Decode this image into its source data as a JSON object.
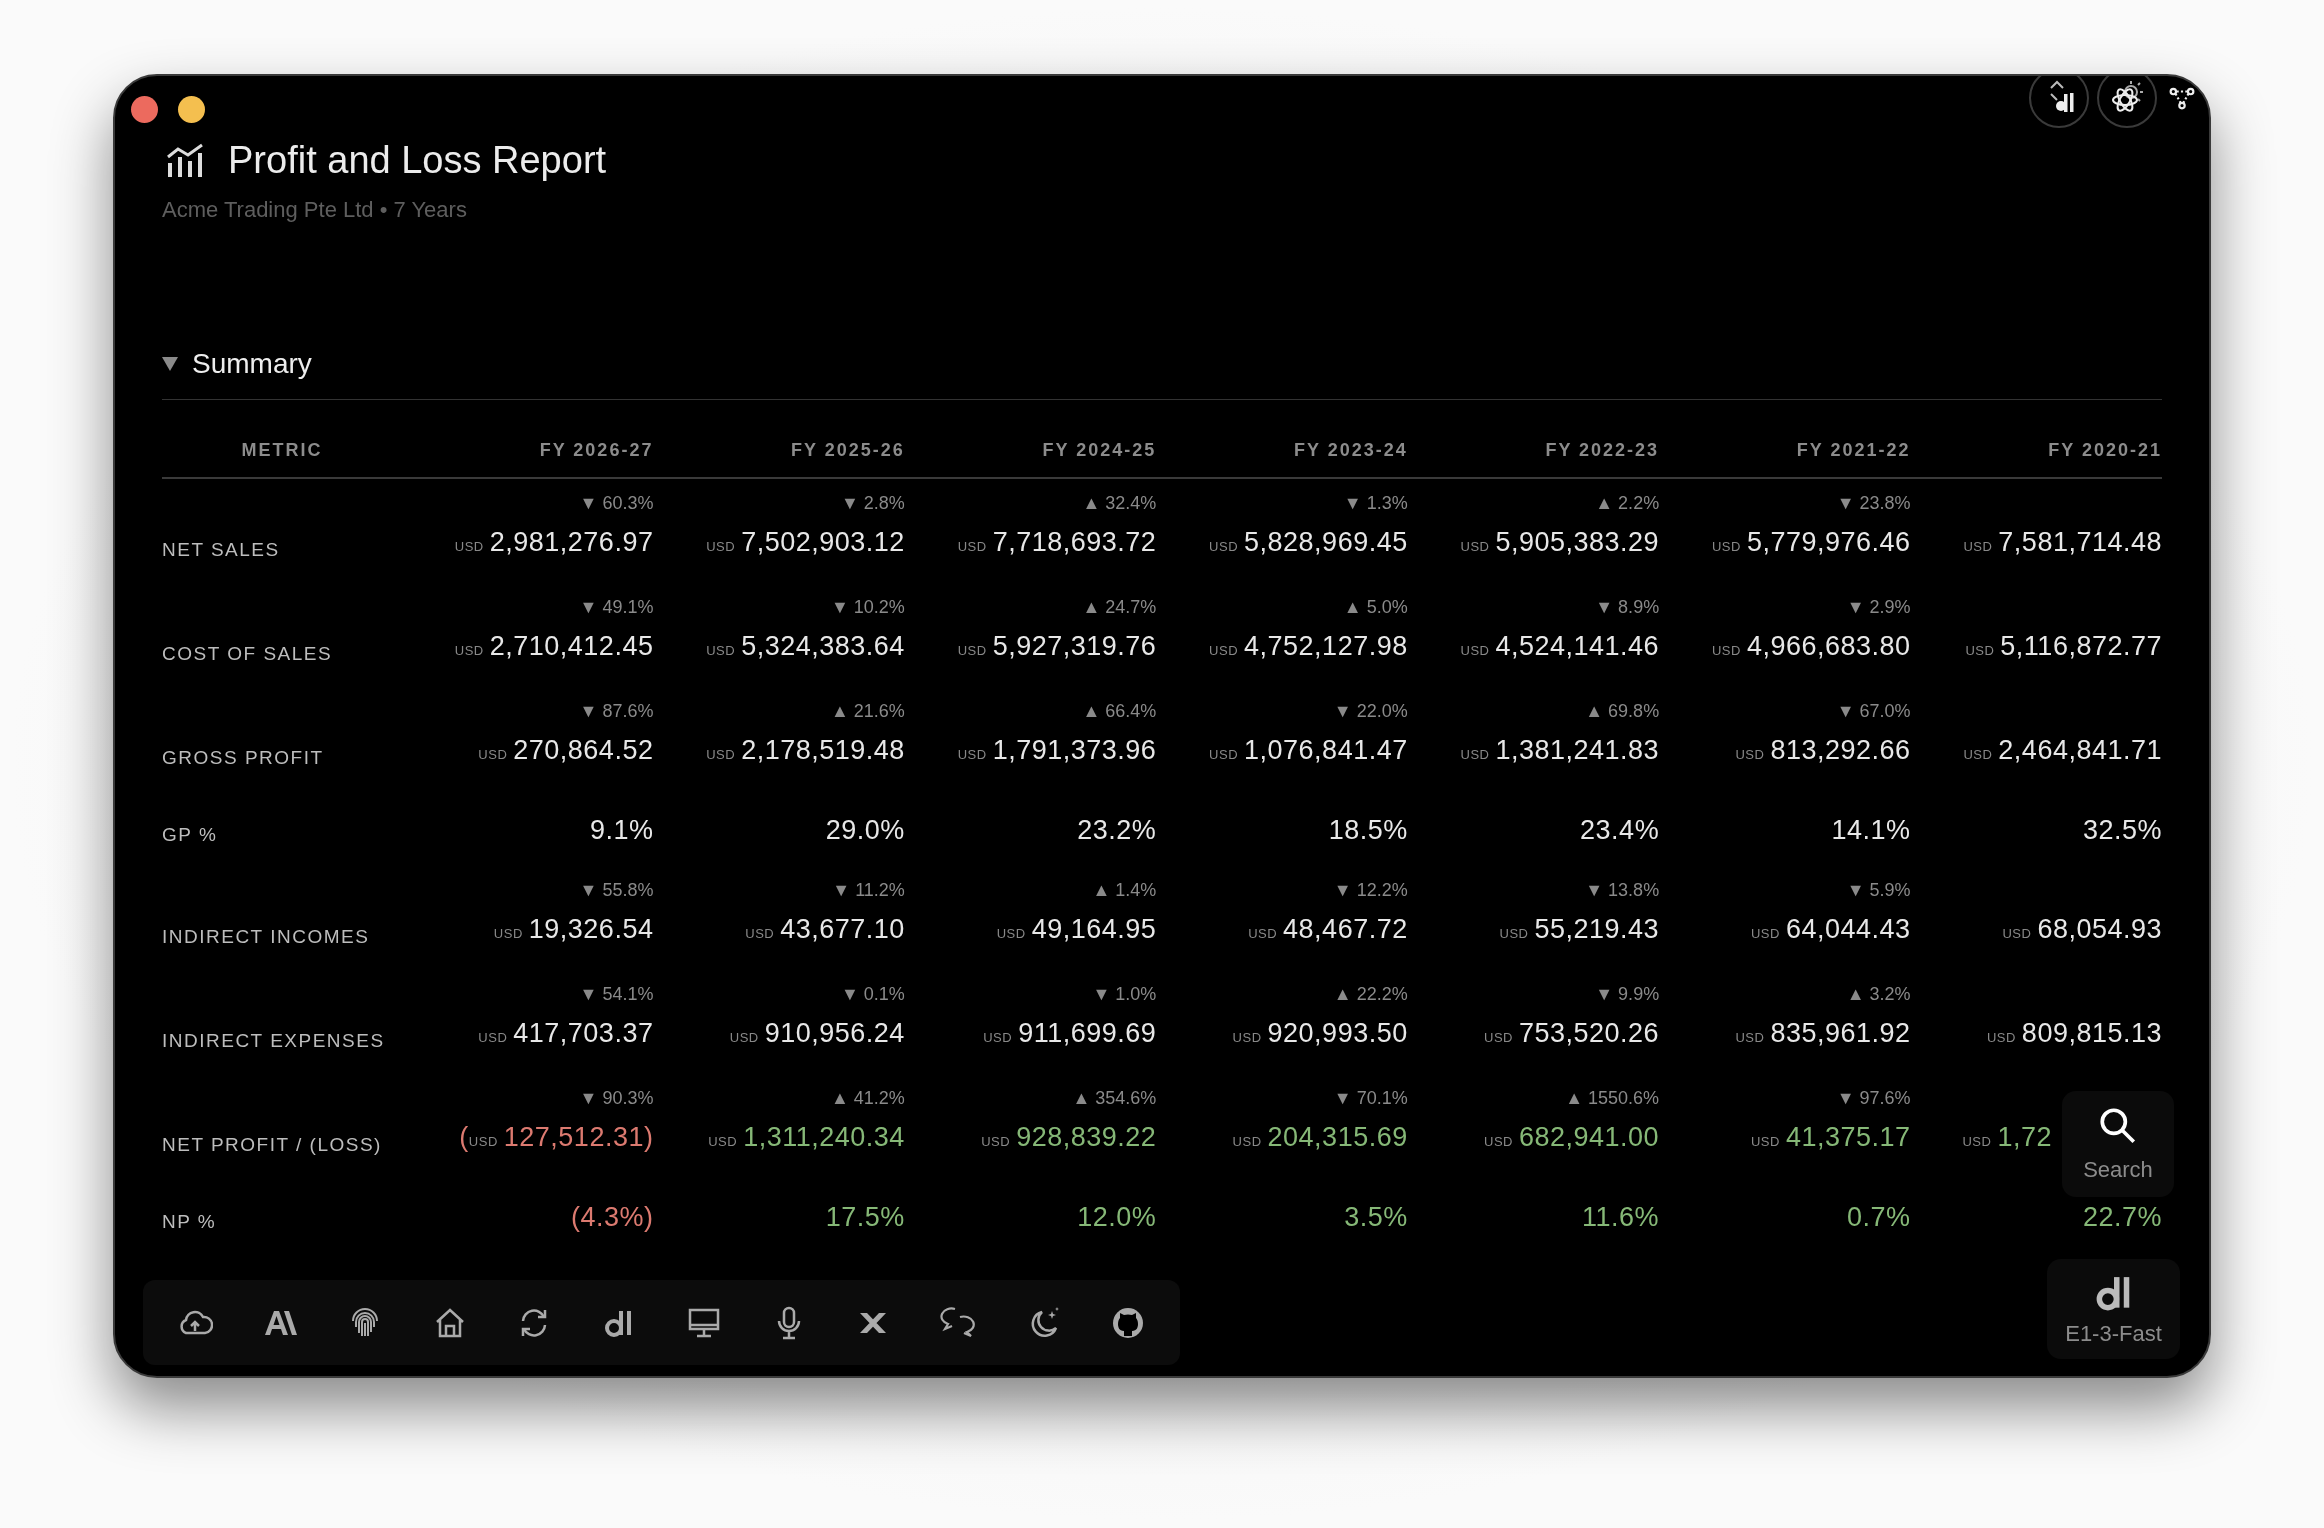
{
  "window": {
    "title": "Profit and Loss Report",
    "subtitle": "Acme Trading Pte Ltd • 7 Years"
  },
  "section": {
    "title": "Summary",
    "expanded": true
  },
  "table": {
    "metric_header": "METRIC",
    "columns": [
      "FY 2026-27",
      "FY 2025-26",
      "FY 2024-25",
      "FY 2023-24",
      "FY 2022-23",
      "FY 2021-22",
      "FY 2020-21"
    ],
    "rows": [
      {
        "label": "NET SALES",
        "cells": [
          {
            "change": "▼ 60.3%",
            "currency": "USD",
            "amount": "2,981,276.97",
            "color": "#e8e8e8"
          },
          {
            "change": "▼ 2.8%",
            "currency": "USD",
            "amount": "7,502,903.12",
            "color": "#e8e8e8"
          },
          {
            "change": "▲ 32.4%",
            "currency": "USD",
            "amount": "7,718,693.72",
            "color": "#e8e8e8"
          },
          {
            "change": "▼ 1.3%",
            "currency": "USD",
            "amount": "5,828,969.45",
            "color": "#e8e8e8"
          },
          {
            "change": "▲ 2.2%",
            "currency": "USD",
            "amount": "5,905,383.29",
            "color": "#e8e8e8"
          },
          {
            "change": "▼ 23.8%",
            "currency": "USD",
            "amount": "5,779,976.46",
            "color": "#e8e8e8"
          },
          {
            "currency": "USD",
            "amount": "7,581,714.48",
            "color": "#e8e8e8"
          }
        ]
      },
      {
        "label": "COST OF SALES",
        "cells": [
          {
            "change": "▼ 49.1%",
            "currency": "USD",
            "amount": "2,710,412.45",
            "color": "#e8e8e8"
          },
          {
            "change": "▼ 10.2%",
            "currency": "USD",
            "amount": "5,324,383.64",
            "color": "#e8e8e8"
          },
          {
            "change": "▲ 24.7%",
            "currency": "USD",
            "amount": "5,927,319.76",
            "color": "#e8e8e8"
          },
          {
            "change": "▲ 5.0%",
            "currency": "USD",
            "amount": "4,752,127.98",
            "color": "#e8e8e8"
          },
          {
            "change": "▼ 8.9%",
            "currency": "USD",
            "amount": "4,524,141.46",
            "color": "#e8e8e8"
          },
          {
            "change": "▼ 2.9%",
            "currency": "USD",
            "amount": "4,966,683.80",
            "color": "#e8e8e8"
          },
          {
            "currency": "USD",
            "amount": "5,116,872.77",
            "color": "#e8e8e8"
          }
        ]
      },
      {
        "label": "GROSS PROFIT",
        "cells": [
          {
            "change": "▼ 87.6%",
            "currency": "USD",
            "amount": "270,864.52",
            "color": "#e8e8e8"
          },
          {
            "change": "▲ 21.6%",
            "currency": "USD",
            "amount": "2,178,519.48",
            "color": "#e8e8e8"
          },
          {
            "change": "▲ 66.4%",
            "currency": "USD",
            "amount": "1,791,373.96",
            "color": "#e8e8e8"
          },
          {
            "change": "▼ 22.0%",
            "currency": "USD",
            "amount": "1,076,841.47",
            "color": "#e8e8e8"
          },
          {
            "change": "▲ 69.8%",
            "currency": "USD",
            "amount": "1,381,241.83",
            "color": "#e8e8e8"
          },
          {
            "change": "▼ 67.0%",
            "currency": "USD",
            "amount": "813,292.66",
            "color": "#e8e8e8"
          },
          {
            "currency": "USD",
            "amount": "2,464,841.71",
            "color": "#e8e8e8"
          }
        ]
      },
      {
        "label": "GP %",
        "cells": [
          {
            "amount": "9.1%",
            "color": "#e8e8e8"
          },
          {
            "amount": "29.0%",
            "color": "#e8e8e8"
          },
          {
            "amount": "23.2%",
            "color": "#e8e8e8"
          },
          {
            "amount": "18.5%",
            "color": "#e8e8e8"
          },
          {
            "amount": "23.4%",
            "color": "#e8e8e8"
          },
          {
            "amount": "14.1%",
            "color": "#e8e8e8"
          },
          {
            "amount": "32.5%",
            "color": "#e8e8e8"
          }
        ]
      },
      {
        "label": "INDIRECT INCOMES",
        "cells": [
          {
            "change": "▼ 55.8%",
            "currency": "USD",
            "amount": "19,326.54",
            "color": "#e8e8e8"
          },
          {
            "change": "▼ 11.2%",
            "currency": "USD",
            "amount": "43,677.10",
            "color": "#e8e8e8"
          },
          {
            "change": "▲ 1.4%",
            "currency": "USD",
            "amount": "49,164.95",
            "color": "#e8e8e8"
          },
          {
            "change": "▼ 12.2%",
            "currency": "USD",
            "amount": "48,467.72",
            "color": "#e8e8e8"
          },
          {
            "change": "▼ 13.8%",
            "currency": "USD",
            "amount": "55,219.43",
            "color": "#e8e8e8"
          },
          {
            "change": "▼ 5.9%",
            "currency": "USD",
            "amount": "64,044.43",
            "color": "#e8e8e8"
          },
          {
            "currency": "USD",
            "amount": "68,054.93",
            "color": "#e8e8e8"
          }
        ]
      },
      {
        "label": "INDIRECT EXPENSES",
        "cells": [
          {
            "change": "▼ 54.1%",
            "currency": "USD",
            "amount": "417,703.37",
            "color": "#e8e8e8"
          },
          {
            "change": "▼ 0.1%",
            "currency": "USD",
            "amount": "910,956.24",
            "color": "#e8e8e8"
          },
          {
            "change": "▼ 1.0%",
            "currency": "USD",
            "amount": "911,699.69",
            "color": "#e8e8e8"
          },
          {
            "change": "▲ 22.2%",
            "currency": "USD",
            "amount": "920,993.50",
            "color": "#e8e8e8"
          },
          {
            "change": "▼ 9.9%",
            "currency": "USD",
            "amount": "753,520.26",
            "color": "#e8e8e8"
          },
          {
            "change": "▲ 3.2%",
            "currency": "USD",
            "amount": "835,961.92",
            "color": "#e8e8e8"
          },
          {
            "currency": "USD",
            "amount": "809,815.13",
            "color": "#e8e8e8"
          }
        ]
      },
      {
        "label": "NET PROFIT / (LOSS)",
        "cells": [
          {
            "change": "▼ 90.3%",
            "lead": "(",
            "currency": "USD",
            "amount": "127,512.31)",
            "color": "#dc7a70"
          },
          {
            "change": "▲ 41.2%",
            "currency": "USD",
            "amount": "1,311,240.34",
            "color": "#86b877"
          },
          {
            "change": "▲ 354.6%",
            "currency": "USD",
            "amount": "928,839.22",
            "color": "#86b877"
          },
          {
            "change": "▼ 70.1%",
            "currency": "USD",
            "amount": "204,315.69",
            "color": "#86b877"
          },
          {
            "change": "▲ 1550.6%",
            "currency": "USD",
            "amount": "682,941.00",
            "color": "#86b877"
          },
          {
            "change": "▼ 97.6%",
            "currency": "USD",
            "amount": "41,375.17",
            "color": "#86b877"
          },
          {
            "currency": "USD",
            "amount": "1,72",
            "color": "#86b877",
            "cut": true
          }
        ]
      },
      {
        "label": "NP %",
        "cells": [
          {
            "amount": "(4.3%)",
            "color": "#dc7a70"
          },
          {
            "amount": "17.5%",
            "color": "#86b877"
          },
          {
            "amount": "12.0%",
            "color": "#86b877"
          },
          {
            "amount": "3.5%",
            "color": "#86b877"
          },
          {
            "amount": "11.6%",
            "color": "#86b877"
          },
          {
            "amount": "0.7%",
            "color": "#86b877"
          },
          {
            "amount": "22.7%",
            "color": "#86b877"
          }
        ]
      }
    ]
  },
  "search_button": {
    "label": "Search"
  },
  "model_badge": {
    "label": "E1-3-Fast"
  }
}
